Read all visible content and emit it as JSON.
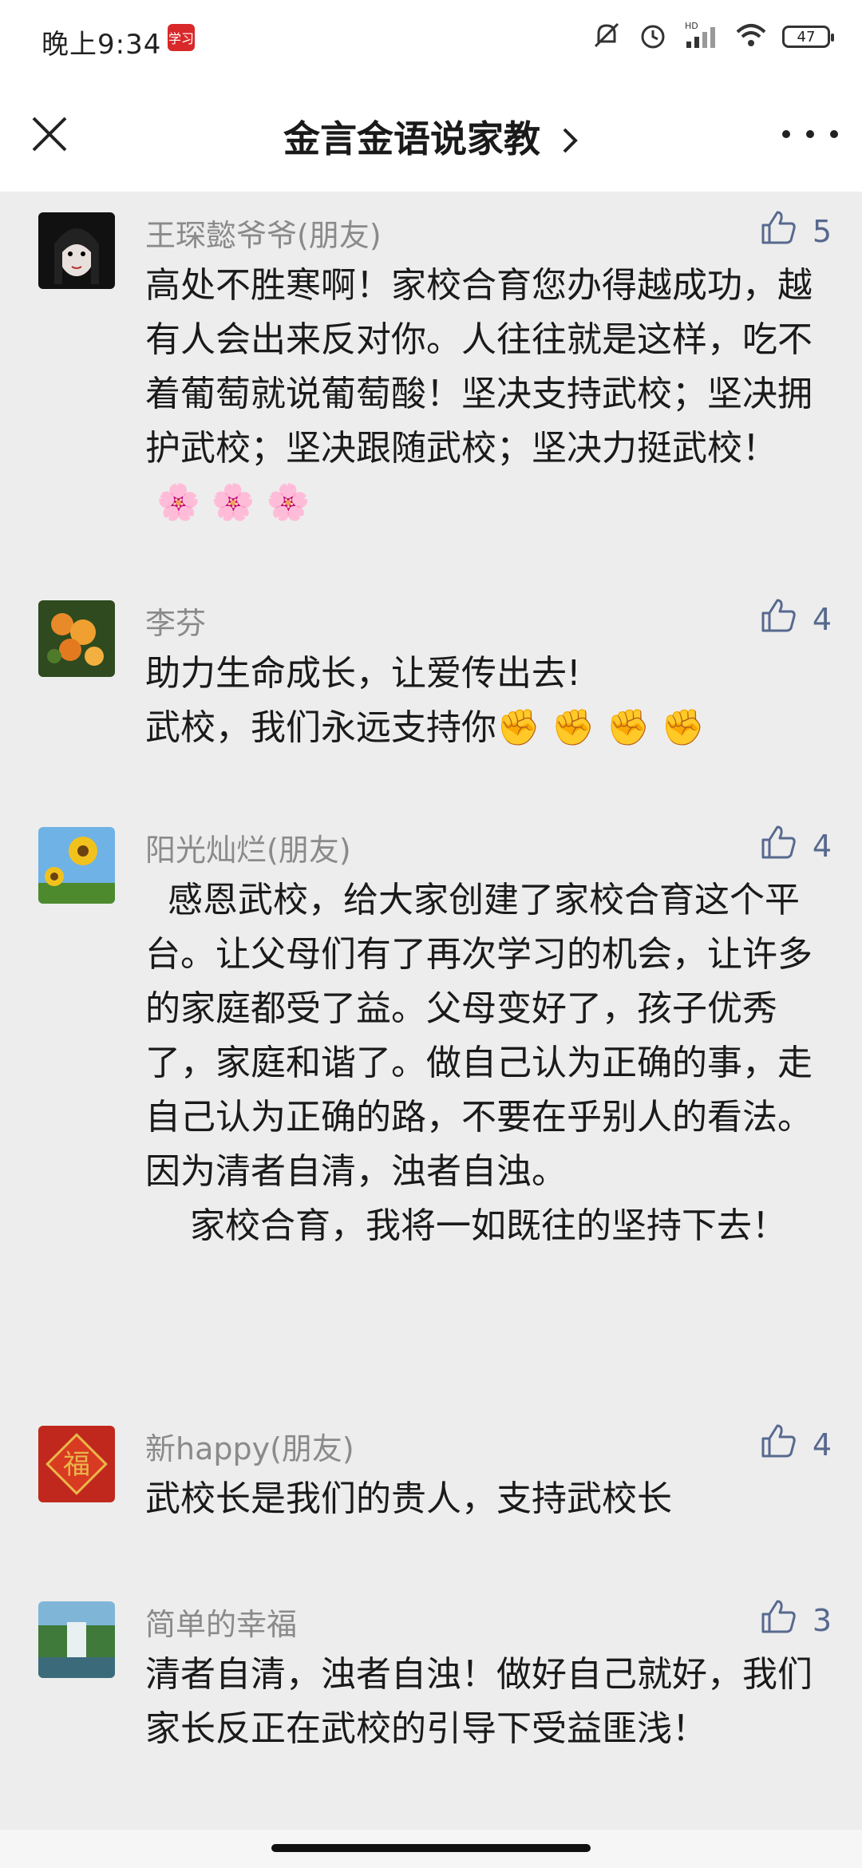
{
  "status_bar": {
    "time": "晚上9:34",
    "app_icon_label": "学习",
    "battery": "47",
    "icons": [
      "mute-icon",
      "alarm-icon",
      "hd-signal-icon",
      "wifi-icon",
      "battery-icon"
    ]
  },
  "nav": {
    "title": "金言金语说家教",
    "close_icon": "close-icon",
    "more_icon": "more-icon"
  },
  "comments": [
    {
      "author": "王琛懿爷爷(朋友)",
      "likes": "5",
      "text": "高处不胜寒啊！家校合育您办得越成功，越有人会出来反对你。人往往就是这样，吃不着葡萄就说葡萄酸！坚决支持武校；坚决拥护武校；坚决跟随武校；坚决力挺武校！",
      "emoji": "🌸 🌸 🌸"
    },
    {
      "author": "李芬",
      "likes": "4",
      "text": "助力生命成长，让爱传出去!\n武校，我们永远支持你",
      "emoji": "✊ ✊ ✊ ✊"
    },
    {
      "author": "阳光灿烂(朋友)",
      "likes": "4",
      "text": "  感恩武校，给大家创建了家校合育这个平台。让父母们有了再次学习的机会，让许多的家庭都受了益。父母变好了，孩子优秀了，家庭和谐了。做自己认为正确的事，走自己认为正确的路，不要在乎别人的看法。因为清者自清，浊者自浊。\n    家校合育，我将一如既往的坚持下去！",
      "emoji": ""
    },
    {
      "author": "新happy(朋友)",
      "likes": "4",
      "text": "武校长是我们的贵人，支持武校长",
      "emoji": ""
    },
    {
      "author": "简单的幸福",
      "likes": "3",
      "text": "清者自清，浊者自浊！做好自己就好，我们家长反正在武校的引导下受益匪浅！",
      "emoji": ""
    }
  ],
  "colors": {
    "background": "#ededed",
    "like_blue": "#57698f",
    "author_gray": "#8a8a8a",
    "text": "#1a1a1a"
  }
}
